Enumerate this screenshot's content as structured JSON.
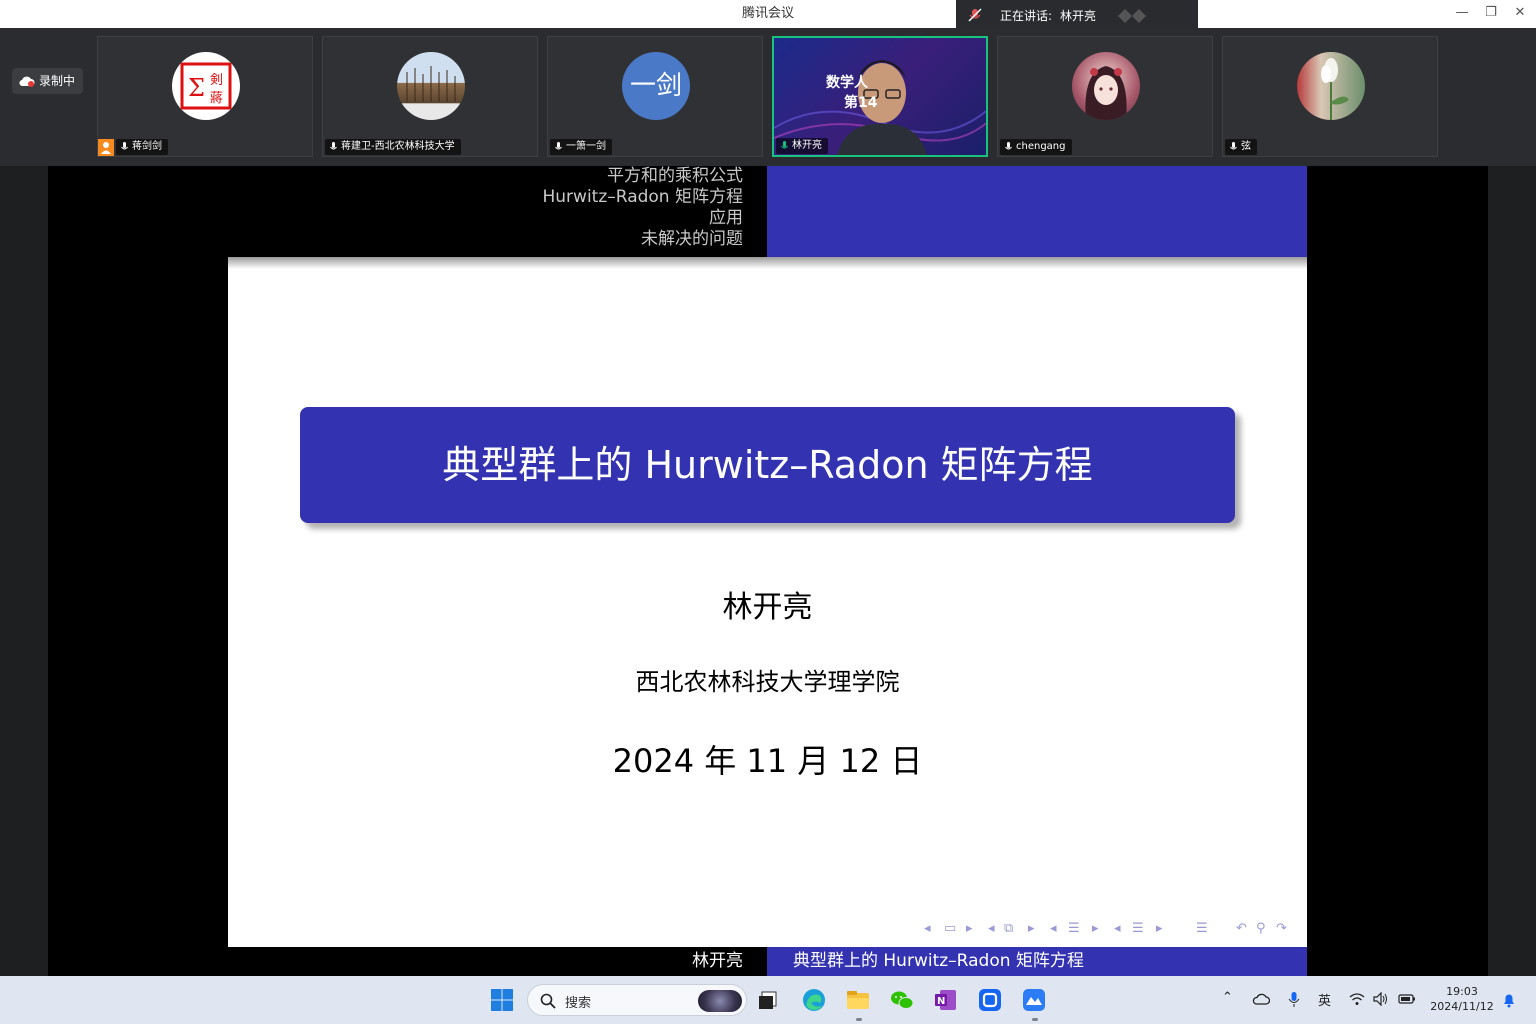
{
  "window": {
    "title": "腾讯会议",
    "speaking_label": "正在讲话:",
    "speaking_name": "林开亮",
    "minimize": "—",
    "restore": "❐",
    "close": "✕"
  },
  "recording": {
    "label": "录制中"
  },
  "participants": [
    {
      "name": "蒋剑剑",
      "host": true,
      "active": false,
      "avatar": "seal-logo"
    },
    {
      "name": "蒋建卫-西北农林科技大学",
      "host": false,
      "active": false,
      "avatar": "winter-trees-photo"
    },
    {
      "name": "一箫一剑",
      "host": false,
      "active": false,
      "avatar": "text-avatar",
      "avatar_text": "一剑"
    },
    {
      "name": "林开亮",
      "host": false,
      "active": true,
      "avatar": "camera-video",
      "video_overlay_line1": "数学人",
      "video_overlay_line2": "第14"
    },
    {
      "name": "chengang",
      "host": false,
      "active": false,
      "avatar": "anime-portrait"
    },
    {
      "name": "弦",
      "host": false,
      "active": false,
      "avatar": "white-flower-photo"
    }
  ],
  "slide": {
    "header_sections": [
      "平方和的乘积公式",
      "Hurwitz–Radon 矩阵方程",
      "应用",
      "未解决的问题"
    ],
    "title": "典型群上的 Hurwitz–Radon 矩阵方程",
    "author": "林开亮",
    "institute": "西北农林科技大学理学院",
    "date": "2024 年 11 月 12 日",
    "footer_author": "林开亮",
    "footer_title": "典型群上的 Hurwitz–Radon 矩阵方程",
    "colors": {
      "accent": "#3333b2",
      "header_text": "#c8c8c8"
    }
  },
  "taskbar": {
    "search_placeholder": "搜索",
    "ime": "英",
    "time": "19:03",
    "date": "2024/11/12",
    "pinned": [
      "windows-start-icon",
      "task-view-icon",
      "edge-icon",
      "file-explorer-icon",
      "wechat-icon",
      "onenote-icon",
      "tencent-meeting-icon",
      "feishu-icon"
    ]
  }
}
